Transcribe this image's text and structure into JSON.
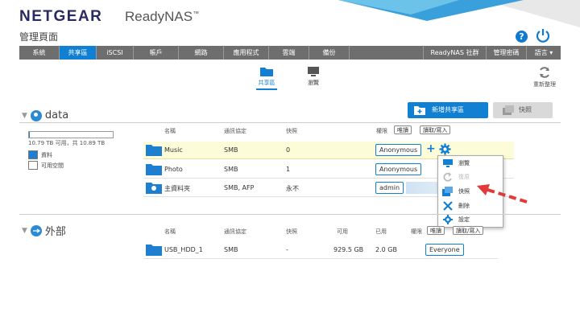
{
  "brand": {
    "logo": "NETGEAR",
    "product": "ReadyNAS",
    "tm": "™"
  },
  "page_title": "管理頁面",
  "nav": {
    "items": [
      "系統",
      "共享區",
      "iSCSI",
      "帳戶",
      "網路",
      "應用程式",
      "雲端",
      "備份"
    ],
    "active_index": 1,
    "right_items": [
      "ReadyNAS 社群",
      "管理密碼",
      "語言 ▾"
    ]
  },
  "sub_tabs": {
    "shares": "共享區",
    "browse": "瀏覽"
  },
  "refresh_label": "重新整理",
  "buttons": {
    "new_share": "新增共享區",
    "snapshot": "快照"
  },
  "headers": {
    "name": "名稱",
    "protocol": "通訊協定",
    "snapshot": "快照",
    "available": "可用",
    "used": "已用",
    "permission": "權限",
    "readonly": "唯讀",
    "readwrite": "讀取/寫入"
  },
  "volume_data": {
    "name": "data",
    "capacity_text": "10.79 TB 可用，共 10.89 TB",
    "used_fraction": 0.01,
    "legend": {
      "data": "資料",
      "free": "可用空間"
    },
    "shares": [
      {
        "name": "Music",
        "protocol": "SMB",
        "snapshots": "0",
        "permission": "Anonymous"
      },
      {
        "name": "Photo",
        "protocol": "SMB",
        "snapshots": "1",
        "permission": "Anonymous"
      },
      {
        "name": "主資料夾",
        "protocol": "SMB, AFP",
        "snapshots": "永不",
        "permission": "admin"
      }
    ]
  },
  "volume_external": {
    "name": "外部",
    "shares": [
      {
        "name": "USB_HDD_1",
        "protocol": "SMB",
        "snapshots": "-",
        "available": "929.5 GB",
        "used": "2.0 GB",
        "permission": "Everyone"
      }
    ]
  },
  "context_menu": [
    {
      "label": "瀏覽",
      "icon": "browse-icon",
      "disabled": false
    },
    {
      "label": "復原",
      "icon": "restore-icon",
      "disabled": true
    },
    {
      "label": "快照",
      "icon": "snapshot-icon",
      "disabled": false
    },
    {
      "label": "刪除",
      "icon": "delete-icon",
      "disabled": false
    },
    {
      "label": "設定",
      "icon": "settings-icon",
      "disabled": false
    }
  ],
  "colors": {
    "accent": "#1180d3",
    "nav_bg": "#6e6e6e",
    "highlight_row": "#fdfcd9",
    "arrow": "#e03a3a"
  }
}
